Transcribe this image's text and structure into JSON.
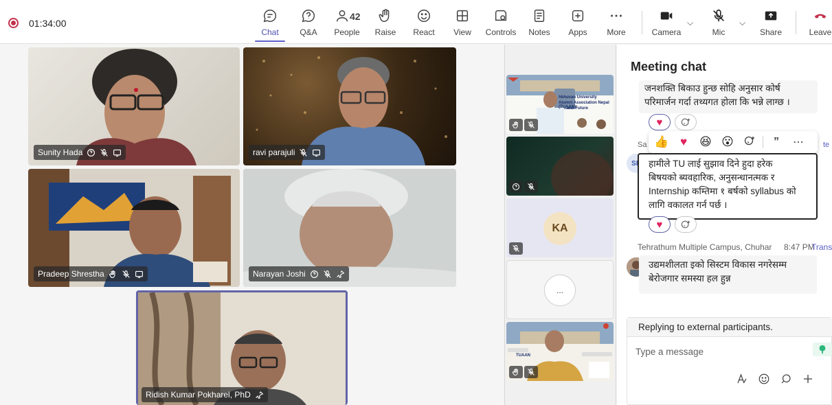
{
  "toolbar": {
    "timer": "01:34:00",
    "items": [
      {
        "label": "Chat",
        "icon": "chat-icon"
      },
      {
        "label": "Q&A",
        "icon": "qa-icon"
      },
      {
        "label": "People",
        "icon": "people-icon",
        "count": "42"
      },
      {
        "label": "Raise",
        "icon": "raise-hand-icon"
      },
      {
        "label": "React",
        "icon": "react-icon"
      },
      {
        "label": "View",
        "icon": "view-icon"
      },
      {
        "label": "Controls",
        "icon": "controls-icon"
      },
      {
        "label": "Notes",
        "icon": "notes-icon"
      },
      {
        "label": "Apps",
        "icon": "apps-icon"
      },
      {
        "label": "More",
        "icon": "more-icon"
      },
      {
        "label": "Camera",
        "icon": "camera-icon"
      },
      {
        "label": "Mic",
        "icon": "mic-off-icon"
      },
      {
        "label": "Share",
        "icon": "share-icon"
      },
      {
        "label": "Leave",
        "icon": "leave-icon"
      }
    ]
  },
  "participants": [
    {
      "name": "Sunity Hada"
    },
    {
      "name": "ravi parajuli"
    },
    {
      "name": "Pradeep Shrestha"
    },
    {
      "name": "Narayan Joshi"
    },
    {
      "name": "Ridish Kumar Pokharel, PhD"
    }
  ],
  "strip": {
    "slide_text_1": "hbhuvan University",
    "slide_text_2": "Alumni Association Nepal (TUAAN):",
    "slide_text_3": "and Future",
    "initials_tile": "KA",
    "more_tile": "...",
    "slide_text_4": "TUAAN"
  },
  "chat": {
    "title": "Meeting chat",
    "msg_prev_1": "जनशक्ति बिकाउ हुन्छ सोहि अनुसार कोर्ष",
    "msg_prev_2": "परिमार्जन गर्दा तथ्यगत होला कि भन्ने लाग्छ ।",
    "sender_fragment": "Sa",
    "translate_fragment": "te",
    "sb_initials": "SB",
    "msg_sel_1": "हामीले TU लाई सुझाव दिने हुदा हरेक",
    "msg_sel_2": "बिषयको ब्यवहारिक, अनुसन्धानत्मक र",
    "msg_sel_3": "Internship कम्तिमा १ बर्षको syllabus को",
    "msg_sel_4": "लागि वकालत गर्न पर्छ ।",
    "sender3": "Tehrathum Multiple Campus, Chuhar",
    "time3": "8:47 PM",
    "translate3": "Transl",
    "msg3_1": "उद्यमशीलता इको सिस्टम  विकास नगरेसम्म",
    "msg3_2": "बेरोजगार समस्या हल हुन्न",
    "reply_note": "Replying to external participants.",
    "input_placeholder": "Type a message",
    "colors": {
      "heart": "#e0245e",
      "accent": "#5b5fc7"
    }
  }
}
